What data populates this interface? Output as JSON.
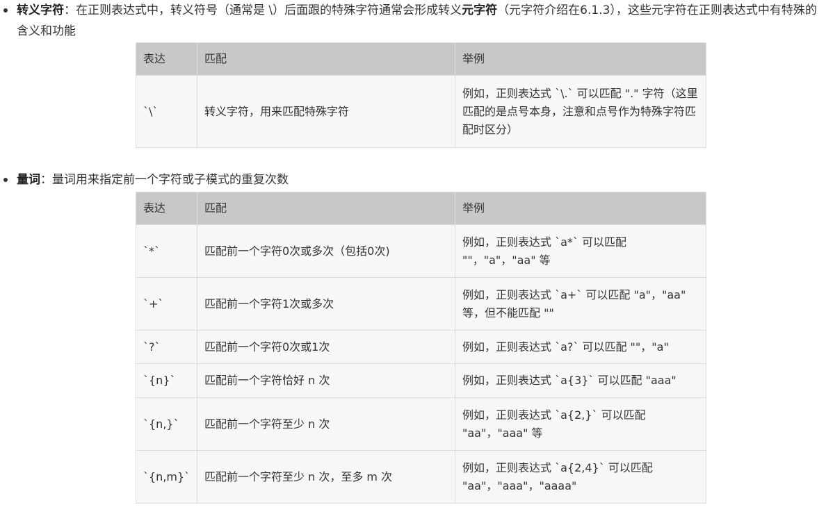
{
  "escape": {
    "term": "转义字符",
    "colon": "：",
    "text_before": "在正则表达式中，转义符号（通常是 \\）后面跟的特殊字符通常会形成转义",
    "strong": "元字符",
    "text_after": "（元字符介绍在6.1.3），这些元字符在正则表达式中有特殊的含义和功能",
    "table": {
      "headers": [
        "表达",
        "匹配",
        "举例"
      ],
      "rows": [
        {
          "expr": "`\\`",
          "match": "转义字符，用来匹配特殊字符",
          "example": "例如，正则表达式 `\\.` 可以匹配 \".\" 字符（这里匹配的是点号本身，注意和点号作为特殊字符匹配时区分）"
        }
      ]
    }
  },
  "quantifier": {
    "term": "量词",
    "colon": "：",
    "text": "量词用来指定前一个字符或子模式的重复次数",
    "table": {
      "headers": [
        "表达",
        "匹配",
        "举例"
      ],
      "rows": [
        {
          "expr": "`*`",
          "match": "匹配前一个字符0次或多次（包括0次)",
          "example": "例如，正则表达式 `a*` 可以匹配 \"\"，\"a\"，\"aa\" 等"
        },
        {
          "expr": "`+`",
          "match": "匹配前一个字符1次或多次",
          "example": "例如，正则表达式 `a+` 可以匹配 \"a\"，\"aa\" 等，但不能匹配 \"\""
        },
        {
          "expr": "`?`",
          "match": "匹配前一个字符0次或1次",
          "example": "例如，正则表达式 `a?` 可以匹配 \"\"，\"a\""
        },
        {
          "expr": "`{n}`",
          "match": "匹配前一个字符恰好 n 次",
          "example": "例如，正则表达式 `a{3}` 可以匹配 \"aaa\""
        },
        {
          "expr": "`{n,}`",
          "match": "匹配前一个字符至少 n 次",
          "example": "例如，正则表达式 `a{2,}` 可以匹配 \"aa\"，\"aaa\" 等"
        },
        {
          "expr": "`{n,m}`",
          "match": "匹配前一个字符至少 n 次，至多 m 次",
          "example": "例如，正则表达式 `a{2,4}` 可以匹配 \"aa\"，\"aaa\"，\"aaaa\""
        }
      ]
    }
  }
}
